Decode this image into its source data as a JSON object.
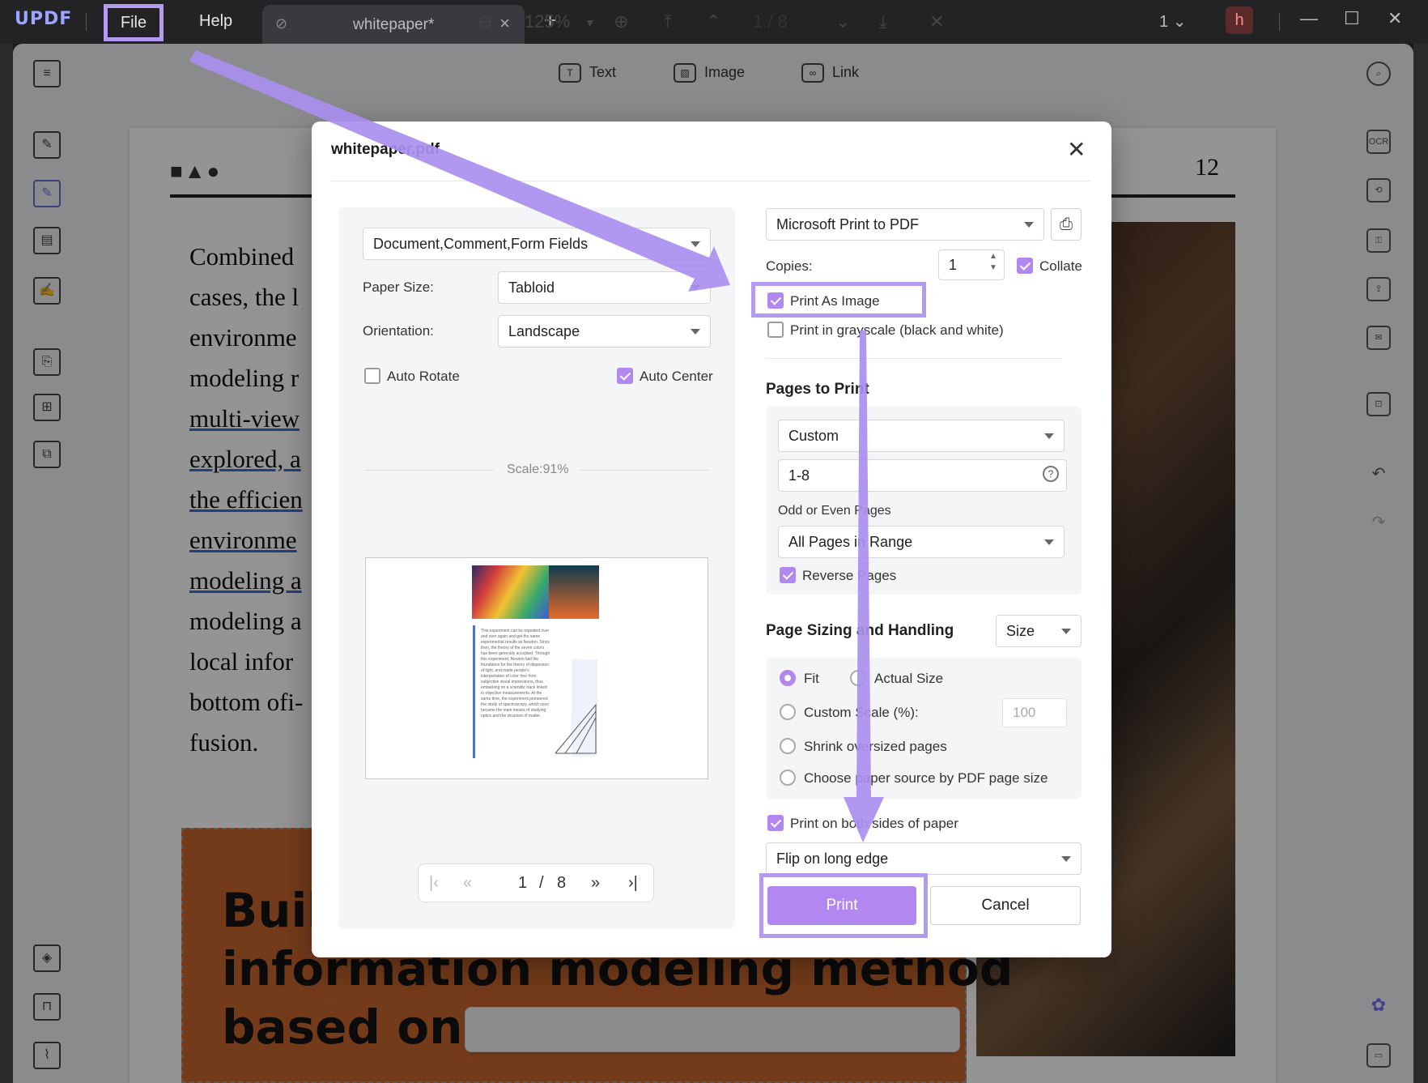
{
  "titlebar": {
    "logo": "UPDF",
    "menu_file": "File",
    "menu_help": "Help",
    "tab_title": "whitepaper*",
    "tab_close": "×",
    "new_tab": "+",
    "page_indicator": "1",
    "avatar_initial": "h"
  },
  "toolbar": {
    "text_label": "Text",
    "image_label": "Image",
    "link_label": "Link"
  },
  "document": {
    "page_number": "12",
    "shapes": "■▲●",
    "body_lines": [
      "Combined",
      "cases, the l",
      "environme",
      "modeling r",
      "multi-view",
      "explored, a",
      "the efficien",
      "environme",
      "modeling a",
      "modeling a",
      "local infor",
      "bottom ofi-",
      "fusion."
    ],
    "big_title_lines": [
      "Buil",
      "information modeling method",
      "based on r"
    ]
  },
  "zoombar": {
    "zoom": "125%",
    "current_page": "1",
    "total_pages": "8",
    "separator": "/"
  },
  "dialog": {
    "title": "whitepaper.pdf",
    "content_select": "Document,Comment,Form Fields",
    "paper_size_label": "Paper Size:",
    "paper_size": "Tabloid",
    "orientation_label": "Orientation:",
    "orientation": "Landscape",
    "auto_rotate": "Auto Rotate",
    "auto_center": "Auto Center",
    "scale_label": "Scale:91%",
    "pager_current": "1",
    "pager_sep": "/",
    "pager_total": "8",
    "printer": "Microsoft Print to PDF",
    "copies_label": "Copies:",
    "copies_value": "1",
    "collate": "Collate",
    "print_as_image": "Print As Image",
    "print_grayscale": "Print in grayscale (black and white)",
    "pages_to_print_title": "Pages to Print",
    "pages_mode": "Custom",
    "pages_range": "1-8",
    "odd_even_label": "Odd or Even Pages",
    "odd_even_value": "All Pages in Range",
    "reverse_pages": "Reverse Pages",
    "sizing_title": "Page Sizing and Handling",
    "sizing_mode": "Size",
    "fit": "Fit",
    "actual_size": "Actual Size",
    "custom_scale": "Custom Scale (%):",
    "custom_scale_value": "100",
    "shrink": "Shrink oversized pages",
    "choose_source": "Choose paper source by PDF page size",
    "both_sides": "Print on both sides of paper",
    "flip": "Flip on long edge",
    "print_button": "Print",
    "cancel_button": "Cancel",
    "preview_text": "This experiment can be repeated over and over again and get the same experimental results as Newton. Since then, the theory of the seven colors has been generally accepted. Through this experiment, Newton laid the foundation for the theory of dispersion of light, and made people's interpretation of color free from subjective visual impressions, thus embarking on a scientific track linked to objective measurements. At the same time, the experiment pioneered the study of spectroscopy, which soon became the main means of studying optics and the structure of matter."
  },
  "colors": {
    "accent": "#b287ef",
    "highlight": "#b29bf0",
    "arrow": "#a98ff0"
  },
  "state": {
    "auto_rotate": false,
    "auto_center": true,
    "collate": true,
    "print_as_image": true,
    "grayscale": false,
    "reverse_pages": true,
    "fit_selected": true,
    "both_sides": true
  }
}
